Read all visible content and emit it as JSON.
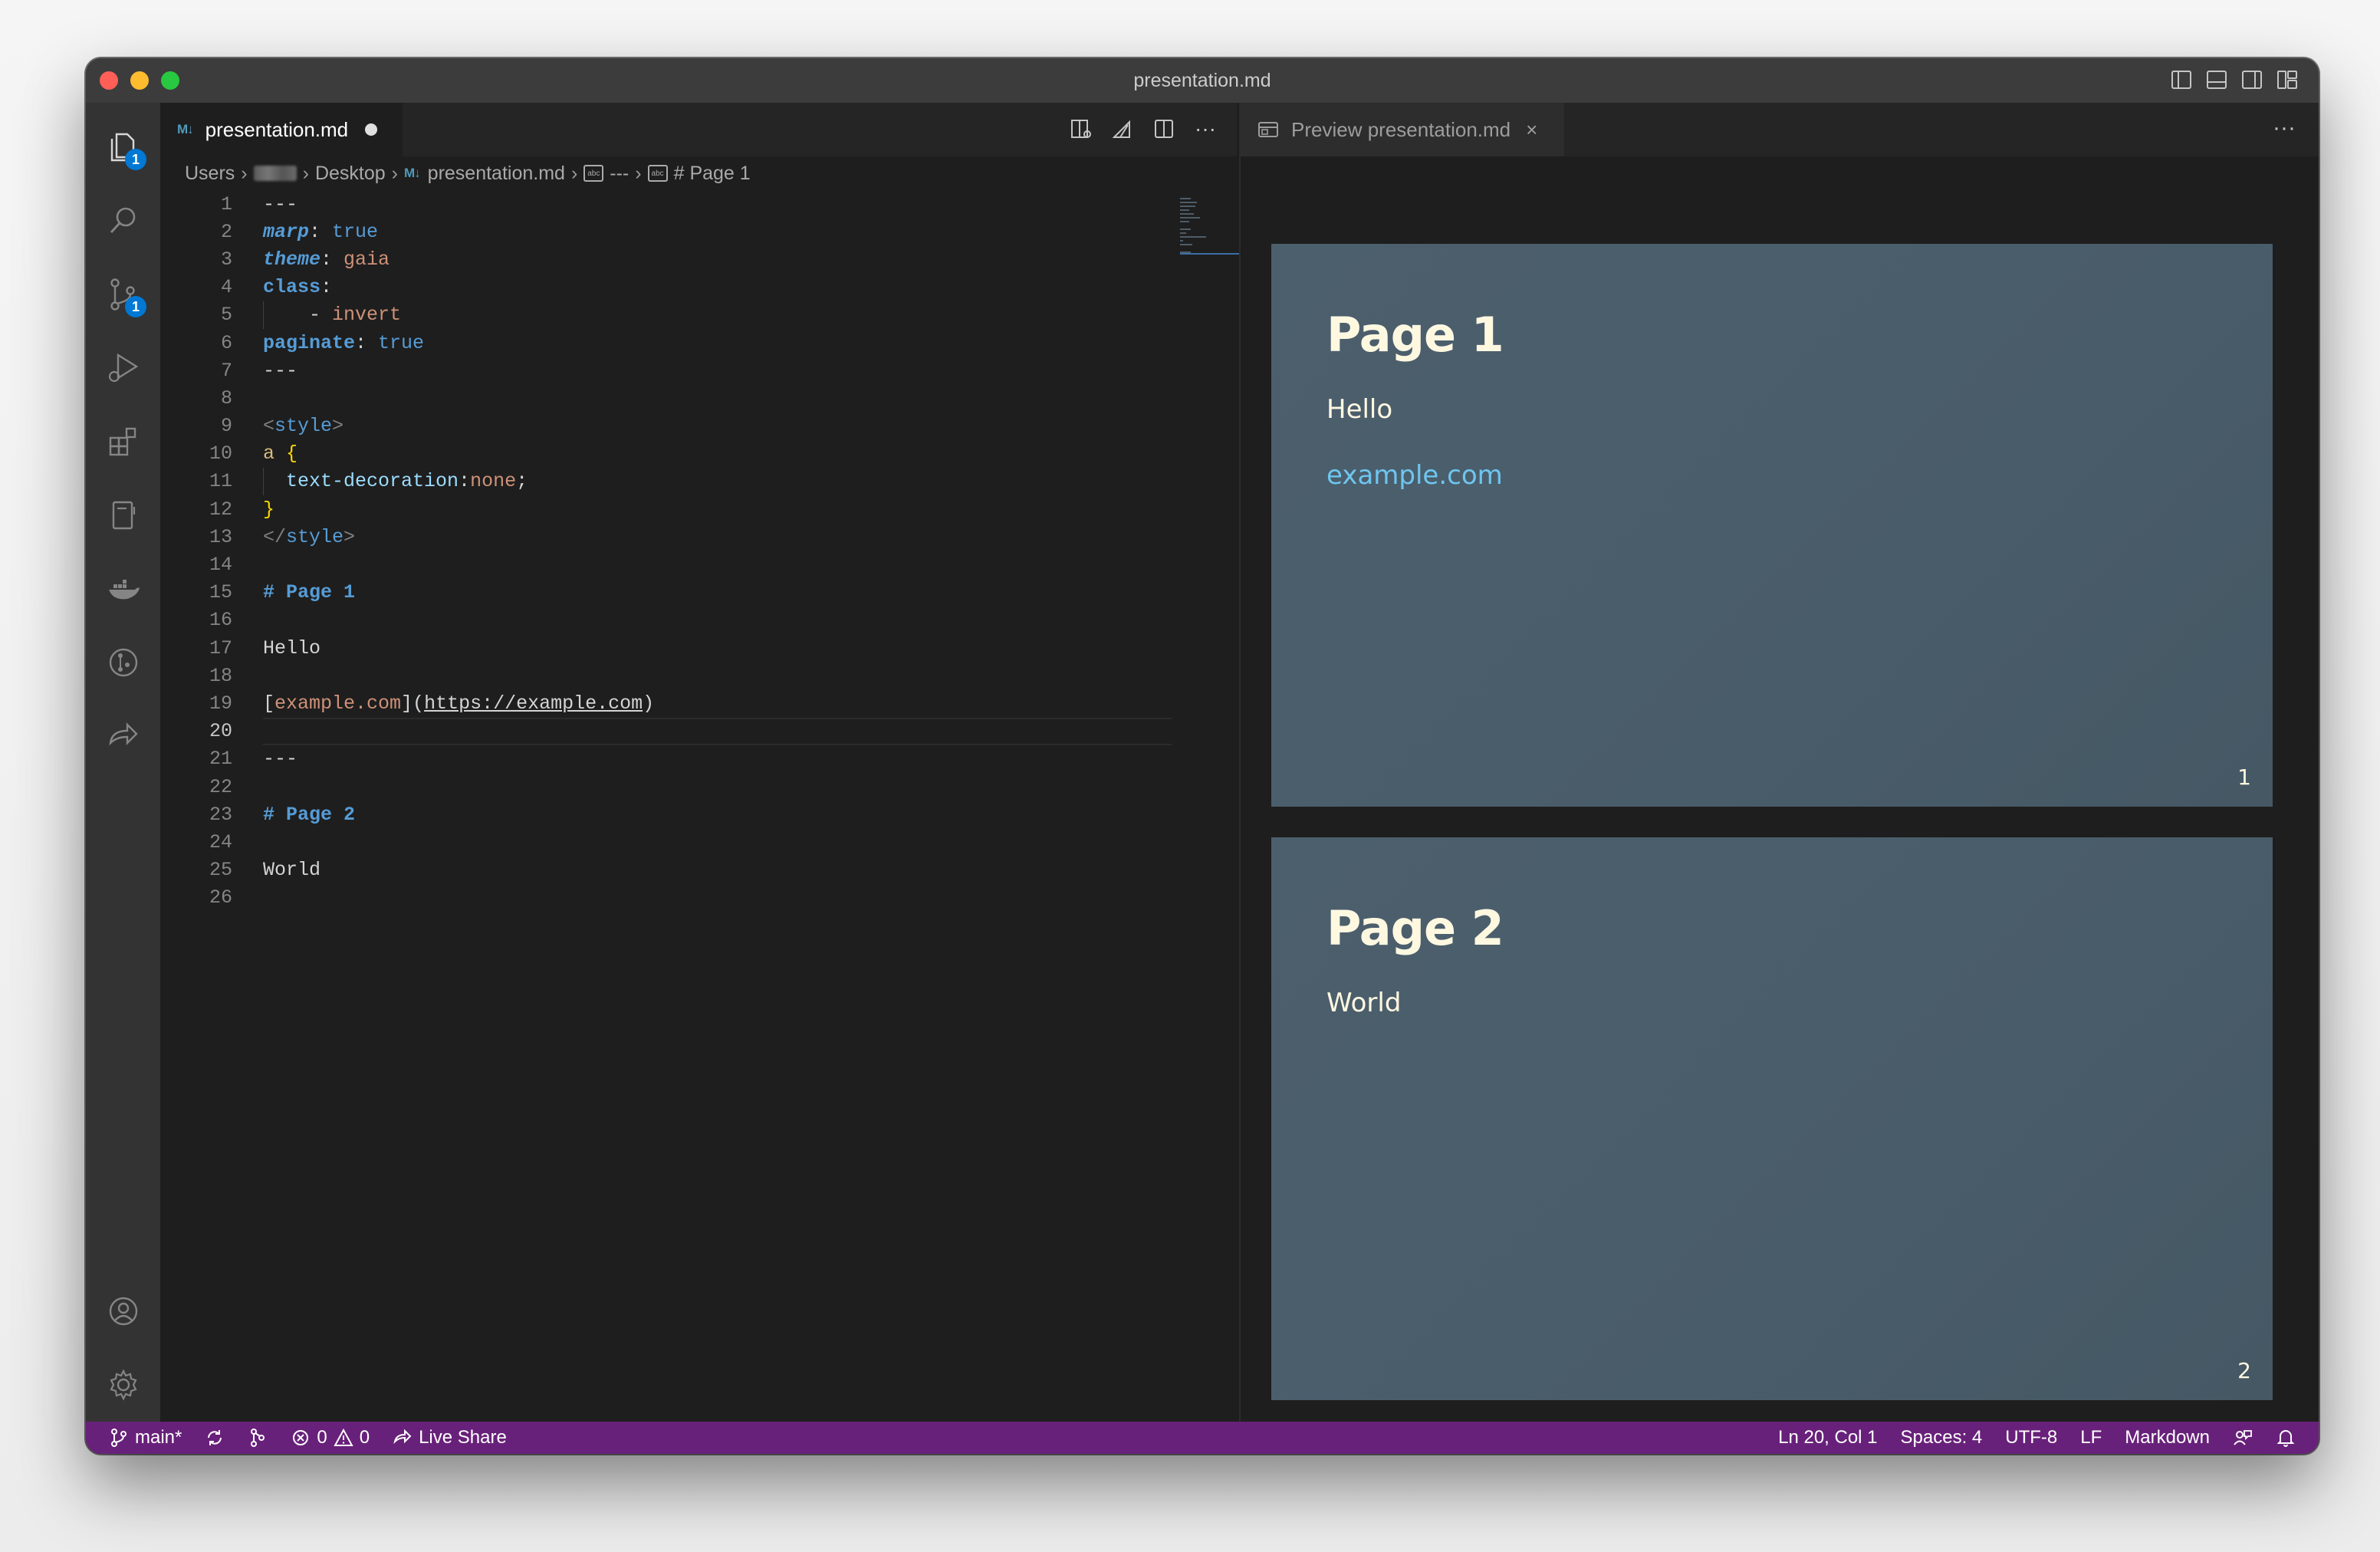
{
  "window": {
    "title": "presentation.md"
  },
  "editor": {
    "tab": {
      "icon_text": "M↓",
      "label": "presentation.md"
    },
    "breadcrumb": [
      "Users",
      "Desktop",
      "presentation.md",
      "---",
      "# Page 1"
    ],
    "active_line": 20,
    "line_numbers": [
      "1",
      "2",
      "3",
      "4",
      "5",
      "6",
      "7",
      "8",
      "9",
      "10",
      "11",
      "12",
      "13",
      "14",
      "15",
      "16",
      "17",
      "18",
      "19",
      "20",
      "21",
      "22",
      "23",
      "24",
      "25",
      "26"
    ],
    "code": {
      "l1": "---",
      "l2k": "marp",
      "l2c": ": ",
      "l2v": "true",
      "l3k": "theme",
      "l3c": ": ",
      "l3v": "gaia",
      "l4k": "class",
      "l4c": ":",
      "l5d": "- ",
      "l5v": "invert",
      "l6k": "paginate",
      "l6c": ": ",
      "l6v": "true",
      "l7": "---",
      "l9a": "<",
      "l9b": "style",
      "l9c": ">",
      "l10a": "a ",
      "l10b": "{",
      "l11a": "text-decoration",
      "l11b": ":",
      "l11c": "none",
      "l11d": ";",
      "l12": "}",
      "l13a": "</",
      "l13b": "style",
      "l13c": ">",
      "l15": "# Page 1",
      "l17": "Hello",
      "l19a": "[",
      "l19b": "example.com",
      "l19c": "](",
      "l19d": "https://example.com",
      "l19e": ")",
      "l21": "---",
      "l23": "# Page 2",
      "l25": "World"
    }
  },
  "preview": {
    "tab_label": "Preview presentation.md",
    "more": "···",
    "slides": [
      {
        "title": "Page 1",
        "text": "Hello",
        "link": "example.com",
        "page": "1"
      },
      {
        "title": "Page 2",
        "text": "World",
        "page": "2"
      }
    ]
  },
  "activity": {
    "explorer_badge": "1",
    "scm_badge": "1"
  },
  "statusbar": {
    "branch": "main*",
    "errors": "0",
    "warnings": "0",
    "live_share": "Live Share",
    "position": "Ln 20, Col 1",
    "spaces": "Spaces: 4",
    "encoding": "UTF-8",
    "eol": "LF",
    "language": "Markdown"
  },
  "colors": {
    "statusbar": "#68217a",
    "slide_bg": "#4a5d6b",
    "link": "#6ec6ef",
    "badge": "#0078d4"
  }
}
